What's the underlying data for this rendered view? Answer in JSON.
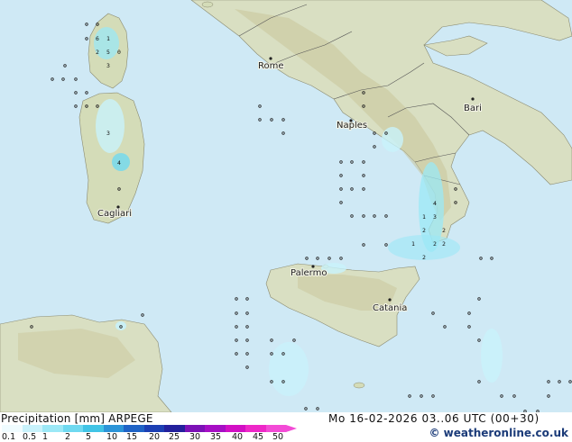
{
  "map": {
    "cities": [
      {
        "name": "Rome"
      },
      {
        "name": "Naples"
      },
      {
        "name": "Bari"
      },
      {
        "name": "Cagliari"
      },
      {
        "name": "Palermo"
      },
      {
        "name": "Catania"
      }
    ]
  },
  "legend": {
    "title": "Precipitation [mm]  ARPEGE",
    "datetime": "Mo 16-02-2026 03..06 UTC (00+30)",
    "credit": "© weatheronline.co.uk",
    "scale": [
      "0.1",
      "0.5",
      "1",
      "2",
      "5",
      "10",
      "15",
      "20",
      "25",
      "30",
      "35",
      "40",
      "45",
      "50"
    ],
    "colors": [
      "#f0fcff",
      "#c8f2fb",
      "#9be8f6",
      "#6fd9f0",
      "#41c4e6",
      "#2c94d8",
      "#1f63c6",
      "#1c3fb3",
      "#23209c",
      "#7c11b6",
      "#a60ec4",
      "#d20fc4",
      "#ee28c8",
      "#f34bd6"
    ]
  }
}
